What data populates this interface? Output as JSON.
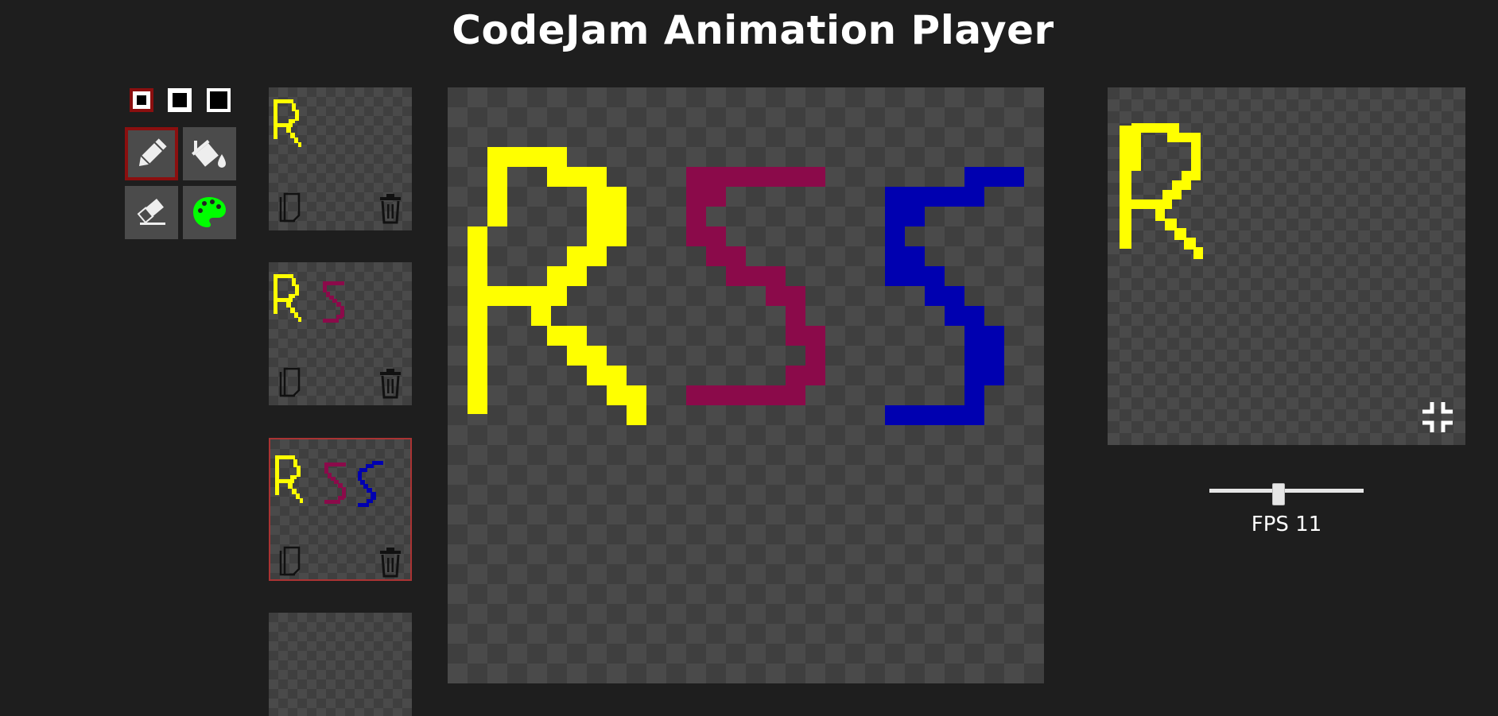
{
  "title": "CodeJam Animation Player",
  "brush_sizes": [
    {
      "name": "small",
      "selected": true
    },
    {
      "name": "medium",
      "selected": false
    },
    {
      "name": "large",
      "selected": false
    }
  ],
  "tools": [
    {
      "name": "pencil",
      "icon": "pencil-icon",
      "active": true
    },
    {
      "name": "fill",
      "icon": "paint-bucket-icon",
      "active": false
    },
    {
      "name": "eraser",
      "icon": "eraser-icon",
      "active": false
    },
    {
      "name": "palette",
      "icon": "palette-icon",
      "active": false,
      "color": "#00ff00"
    }
  ],
  "colors": {
    "yellow": "#ffff00",
    "maroon": "#8b0a4a",
    "blue": "#0000b0",
    "background": "#1e1e1e",
    "selected_border": "#a33333"
  },
  "frames": [
    {
      "letters": [
        "R"
      ],
      "selected": false
    },
    {
      "letters": [
        "R",
        "S"
      ],
      "selected": false
    },
    {
      "letters": [
        "R",
        "S",
        "S"
      ],
      "selected": true
    },
    {
      "letters": [],
      "selected": false
    }
  ],
  "frame_actions": {
    "copy_icon": "copy-icon",
    "delete_icon": "trash-icon"
  },
  "canvas": {
    "letters": [
      "R",
      "S",
      "S"
    ]
  },
  "preview": {
    "letters": [
      "R"
    ],
    "exit_fullscreen_icon": "exit-fullscreen-icon"
  },
  "fps": {
    "label": "FPS 11",
    "value": 11,
    "fraction": 0.45
  }
}
